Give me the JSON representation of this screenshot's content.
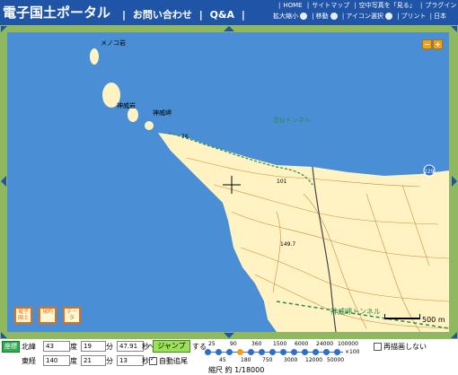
{
  "header": {
    "logo": "電子国土ポータル",
    "logo_kanji": "電",
    "nav_links": [
      "お問い合わせ",
      "Q&A"
    ],
    "top_links": [
      "HOME",
      "サイトマップ",
      "空中写真を「見る」",
      "プラグイン"
    ],
    "tool_links": [
      "拡大縮小",
      "移動",
      "アイコン選択",
      "プリント",
      "日本"
    ]
  },
  "map": {
    "labels": {
      "cape": "神威岬",
      "island": "神威岩",
      "islet": "メノコ岩",
      "trail": "念仏トンネル",
      "tunnel": "神威岬トンネル",
      "h1": "76",
      "h2": "101",
      "h3": "149.7",
      "route": "229"
    },
    "zoom_minus": "−",
    "zoom_plus": "+",
    "side_buttons": [
      {
        "label": "電子国土",
        "icon": "e-kokudo-icon"
      },
      {
        "label": "規約",
        "icon": "rules-icon"
      },
      {
        "label": "データ",
        "icon": "data-icon"
      }
    ],
    "scale_label": "500 m",
    "colors": {
      "sea": "#4a8fd6",
      "land": "#fff3c4",
      "contour": "#c98c3a",
      "frame": "#8fb860"
    }
  },
  "controls": {
    "coord_button": "座標",
    "lat_label": "北緯",
    "lat_deg": "43",
    "deg_label": "度",
    "lat_min": "19",
    "min_label": "分",
    "lat_sec": "47.91",
    "sec_label": "秒",
    "lon_label": "東経",
    "lon_deg": "140",
    "lon_min": "21",
    "lon_sec": "13",
    "to_label": "へ",
    "jump_button": "ジャンプ",
    "do_label": "する",
    "auto_follow": "自動追尾",
    "no_redraw": "再描画しない",
    "scale_top": [
      "25",
      "90",
      "360",
      "1500",
      "6000",
      "24000",
      "100000"
    ],
    "scale_bottom": [
      "45",
      "180",
      "750",
      "3000",
      "12000",
      "50000"
    ],
    "scale_multiplier": "×100",
    "scale_text": "縮尺 約 1/18000"
  }
}
